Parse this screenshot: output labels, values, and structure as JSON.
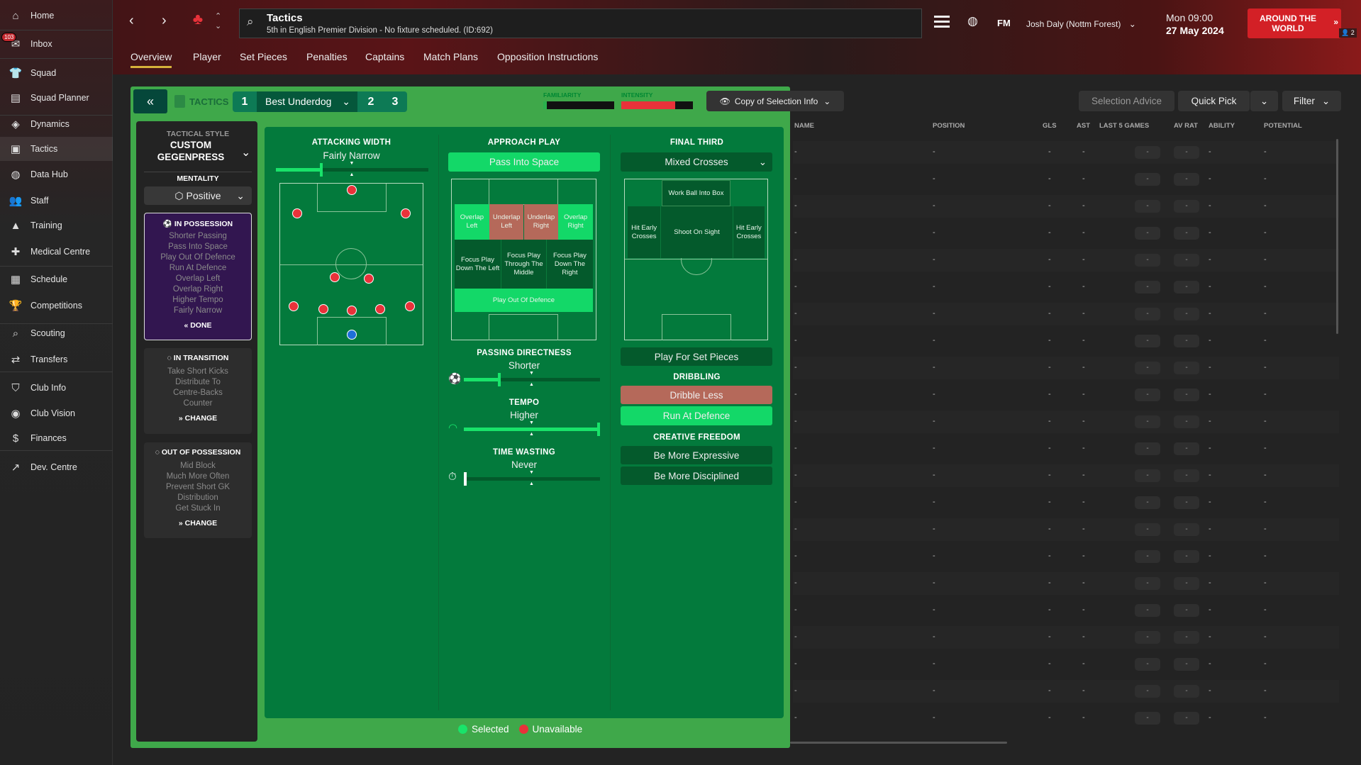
{
  "sidebar": {
    "inbox_badge": "103",
    "items": [
      {
        "label": "Home",
        "icon": "home-icon",
        "glyph": "⌂"
      },
      {
        "label": "Inbox",
        "icon": "inbox-icon",
        "glyph": "✉"
      },
      {
        "label": "Squad",
        "icon": "shirt-icon",
        "glyph": "👕"
      },
      {
        "label": "Squad Planner",
        "icon": "planner-icon",
        "glyph": "▤"
      },
      {
        "label": "Dynamics",
        "icon": "dynamics-icon",
        "glyph": "◈"
      },
      {
        "label": "Tactics",
        "icon": "tactics-icon",
        "glyph": "▣"
      },
      {
        "label": "Data Hub",
        "icon": "data-hub-icon",
        "glyph": "◍"
      },
      {
        "label": "Staff",
        "icon": "staff-icon",
        "glyph": "👥"
      },
      {
        "label": "Training",
        "icon": "training-icon",
        "glyph": "▲"
      },
      {
        "label": "Medical Centre",
        "icon": "medical-icon",
        "glyph": "✚"
      },
      {
        "label": "Schedule",
        "icon": "calendar-icon",
        "glyph": "▦"
      },
      {
        "label": "Competitions",
        "icon": "trophy-icon",
        "glyph": "🏆"
      },
      {
        "label": "Scouting",
        "icon": "scouting-icon",
        "glyph": "⌕"
      },
      {
        "label": "Transfers",
        "icon": "transfers-icon",
        "glyph": "⇄"
      },
      {
        "label": "Club Info",
        "icon": "shield-icon",
        "glyph": "⛉"
      },
      {
        "label": "Club Vision",
        "icon": "vision-icon",
        "glyph": "◉"
      },
      {
        "label": "Finances",
        "icon": "finances-icon",
        "glyph": "$"
      },
      {
        "label": "Dev. Centre",
        "icon": "dev-centre-icon",
        "glyph": "↗"
      }
    ]
  },
  "header": {
    "title": "Tactics",
    "subtitle": "5th in English Premier Division - No fixture scheduled. (ID:692)",
    "fm": "FM",
    "manager": "Josh Daly (Nottm Forest)",
    "time": "Mon 09:00",
    "date": "27 May 2024",
    "continue_label": "AROUND THE WORLD",
    "players_count": "2"
  },
  "tabs": [
    "Overview",
    "Player",
    "Set Pieces",
    "Penalties",
    "Captains",
    "Match Plans",
    "Opposition Instructions"
  ],
  "tacbar": {
    "label": "TACTICS",
    "slot1": "1",
    "tactic_name": "Best Underdog",
    "slot2": "2",
    "slot3": "3",
    "familiarity_label": "FAMILIARITY",
    "intensity_label": "INTENSITY",
    "familiarity": 0.05,
    "intensity": 0.75
  },
  "selection": {
    "copy_label": "Copy of Selection Info",
    "advice": "Selection Advice",
    "quick_pick": "Quick Pick",
    "filter": "Filter"
  },
  "left": {
    "style_label": "TACTICAL STYLE",
    "style_line1": "CUSTOM",
    "style_line2": "GEGENPRESS",
    "mentality_label": "MENTALITY",
    "mentality": "Positive",
    "in_possession": {
      "title": "IN POSSESSION",
      "items": [
        "Shorter Passing",
        "Pass Into Space",
        "Play Out Of Defence",
        "Run At Defence",
        "Overlap Left",
        "Overlap Right",
        "Higher Tempo",
        "Fairly Narrow"
      ],
      "action": "DONE"
    },
    "in_transition": {
      "title": "IN TRANSITION",
      "items": [
        "Take Short Kicks",
        "Distribute To",
        "Centre-Backs",
        "Counter"
      ],
      "action": "CHANGE"
    },
    "out_of_possession": {
      "title": "OUT OF POSSESSION",
      "items": [
        "Mid Block",
        "Much More Often",
        "Prevent Short GK",
        "Distribution",
        "Get Stuck In"
      ],
      "action": "CHANGE"
    }
  },
  "attacking_width": {
    "label": "ATTACKING WIDTH",
    "value": "Fairly Narrow",
    "level": 0.29
  },
  "approach": {
    "label": "APPROACH PLAY",
    "button": "Pass Into Space",
    "zones": {
      "overlap_left": "Overlap Left",
      "underlap_left": "Underlap Left",
      "underlap_right": "Underlap Right",
      "overlap_right": "Overlap Right",
      "focus_left": "Focus Play Down The Left",
      "focus_middle": "Focus Play Through The Middle",
      "focus_right": "Focus Play Down The Right",
      "play_out": "Play Out Of Defence"
    },
    "passing": {
      "label": "PASSING DIRECTNESS",
      "value": "Shorter",
      "level": 0.25
    },
    "tempo": {
      "label": "TEMPO",
      "value": "Higher",
      "level": 1.0
    },
    "time_wasting": {
      "label": "TIME WASTING",
      "value": "Never",
      "level": 0.0
    }
  },
  "final_third": {
    "label": "FINAL THIRD",
    "dropdown": "Mixed Crosses",
    "zones": {
      "work_ball": "Work Ball Into Box",
      "hit_left": "Hit Early Crosses",
      "shoot": "Shoot On Sight",
      "hit_right": "Hit Early Crosses"
    },
    "set_pieces": "Play For Set Pieces",
    "dribbling_label": "DRIBBLING",
    "dribble_less": "Dribble Less",
    "run_at_defence": "Run At Defence",
    "creative_label": "CREATIVE FREEDOM",
    "expressive": "Be More Expressive",
    "disciplined": "Be More Disciplined"
  },
  "legend": {
    "selected": "Selected",
    "unavailable": "Unavailable",
    "selected_color": "#19e36a",
    "unavailable_color": "#e8323a"
  },
  "table": {
    "columns": [
      "NAME",
      "POSITION",
      "GLS",
      "AST",
      "LAST 5 GAMES",
      "AV RAT",
      "ABILITY",
      "POTENTIAL"
    ],
    "empty": "-",
    "row_count": 22
  }
}
